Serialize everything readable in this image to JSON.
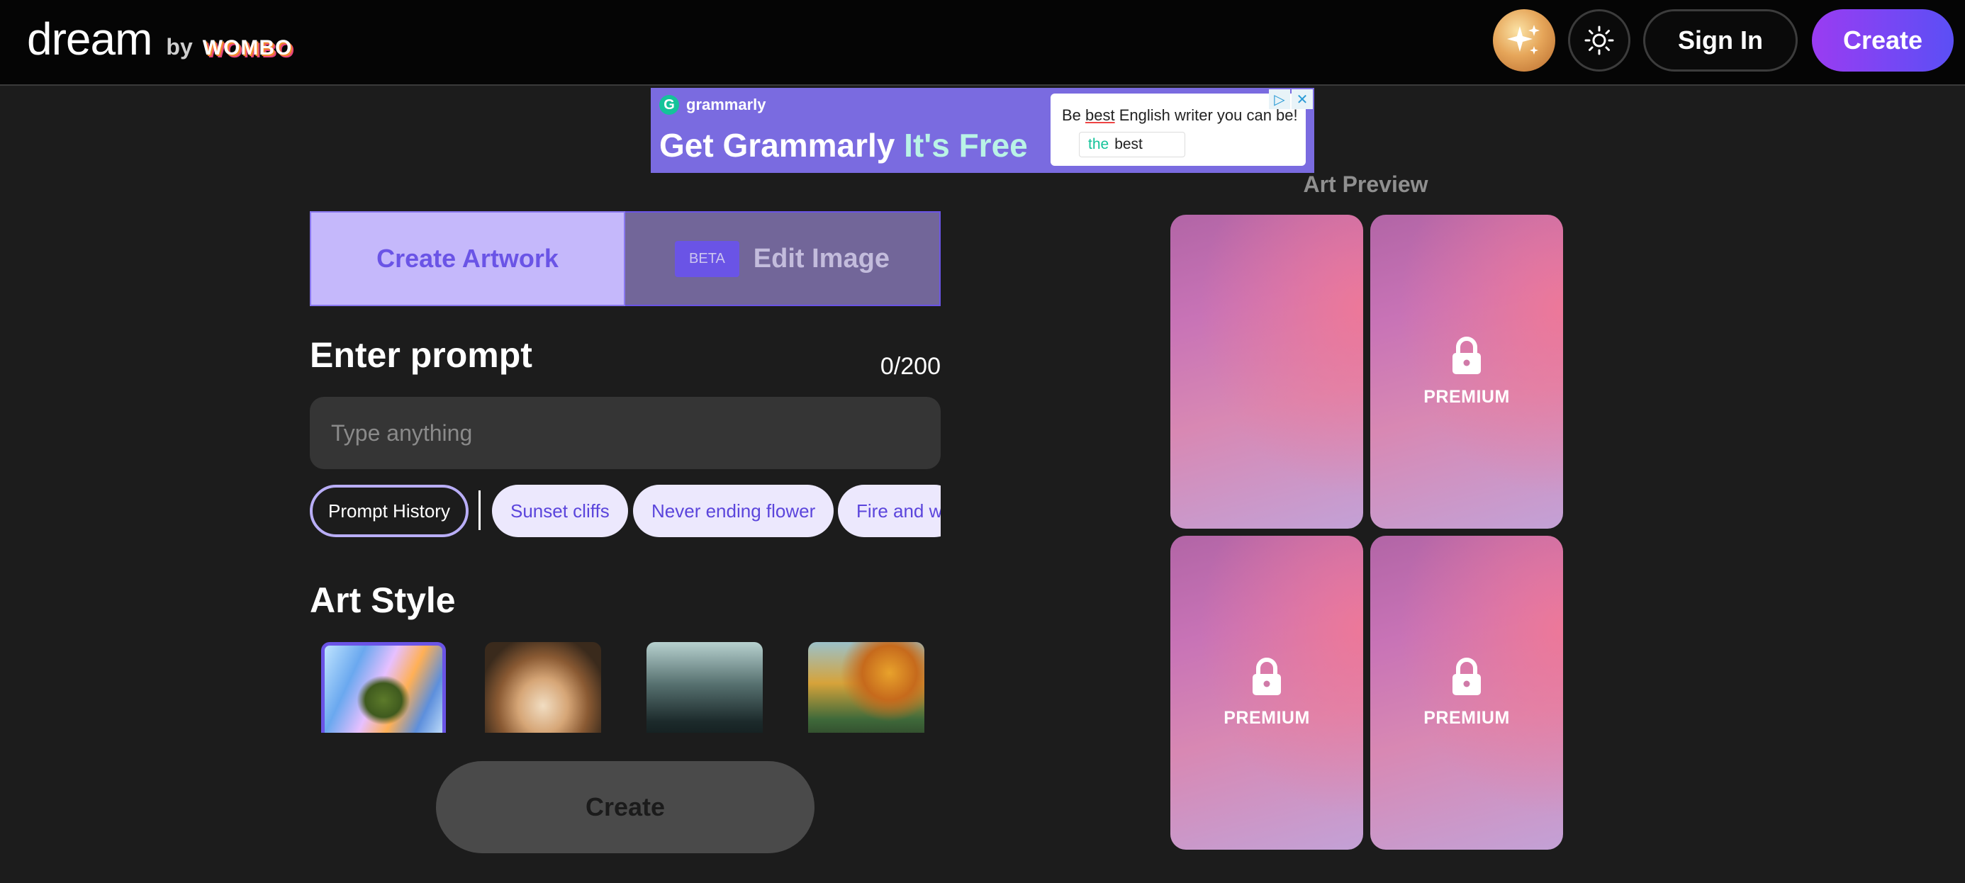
{
  "header": {
    "logo_text": "dream",
    "logo_by": "by",
    "logo_brand": "WOMBO",
    "avatar_icon": "sparkles-icon",
    "theme_icon": "sun-icon",
    "signin_label": "Sign In",
    "create_label": "Create"
  },
  "ad": {
    "brand": "grammarly",
    "brand_mark": "G",
    "headline_main": "Get Grammarly",
    "headline_accent": "It's Free",
    "card_text_before": "Be ",
    "card_text_highlight": "best",
    "card_text_after": " English writer you can be!",
    "chip_green": "the",
    "chip_text": "best",
    "ad_choices": "▷",
    "ad_close": "✕"
  },
  "tabs": {
    "create_label": "Create Artwork",
    "beta_label": "BETA",
    "edit_label": "Edit Image"
  },
  "prompt": {
    "title": "Enter prompt",
    "count": "0/200",
    "placeholder": "Type anything",
    "history_label": "Prompt History",
    "suggestions": [
      "Sunset cliffs",
      "Never ending flower",
      "Fire and w"
    ]
  },
  "art_style": {
    "title": "Art Style"
  },
  "create_button": "Create",
  "preview": {
    "title": "Art Preview",
    "premium_label": "PREMIUM",
    "lock_icon": "lock-icon"
  },
  "colors": {
    "accent": "#6a54e6",
    "create_gradient_start": "#9a3cf2",
    "create_gradient_end": "#5b4ff5",
    "background": "#1c1c1c"
  }
}
